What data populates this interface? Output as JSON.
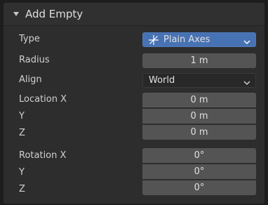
{
  "panel": {
    "title": "Add Empty",
    "rows": {
      "type": {
        "label": "Type",
        "value": "Plain Axes"
      },
      "radius": {
        "label": "Radius",
        "value": "1 m"
      },
      "align": {
        "label": "Align",
        "value": "World"
      },
      "location_x": {
        "label": "Location X",
        "value": "0 m"
      },
      "location_y": {
        "label": "Y",
        "value": "0 m"
      },
      "location_z": {
        "label": "Z",
        "value": "0 m"
      },
      "rotation_x": {
        "label": "Rotation X",
        "value": "0°"
      },
      "rotation_y": {
        "label": "Y",
        "value": "0°"
      },
      "rotation_z": {
        "label": "Z",
        "value": "0°"
      }
    }
  },
  "colors": {
    "accent": "#4772b3",
    "field": "#545454",
    "panel_bg": "#2d2d2d"
  },
  "icons": {
    "collapse": "triangle-down-icon",
    "empty_type": "plain-axes-icon",
    "dropdown": "chevron-down-icon"
  }
}
